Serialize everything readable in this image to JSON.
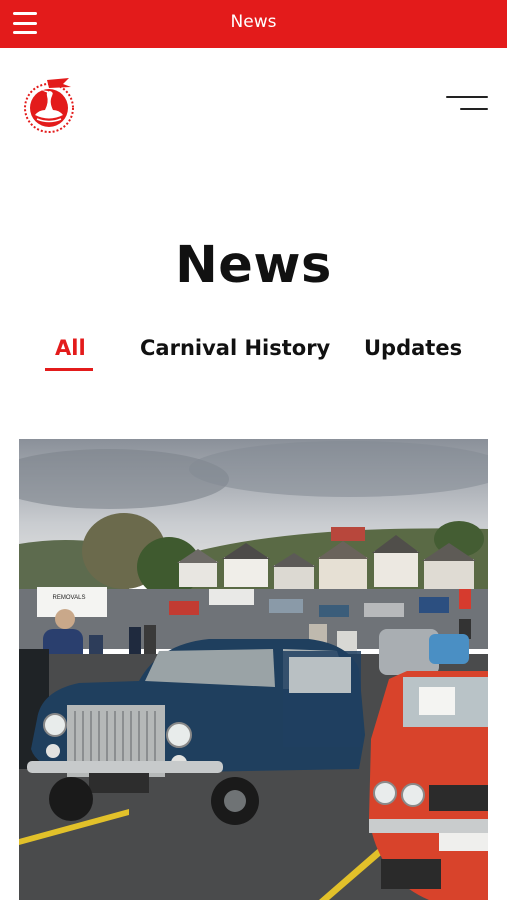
{
  "app_bar": {
    "title": "News",
    "menu_icon": "hamburger-menu-icon",
    "background_color": "#e31b1b"
  },
  "header": {
    "logo_icon": "swan-crest-logo",
    "menu_icon": "two-line-menu-icon"
  },
  "page": {
    "title": "News"
  },
  "tabs": [
    {
      "label": "All",
      "active": true
    },
    {
      "label": "Carnival History",
      "active": false
    },
    {
      "label": "Updates",
      "active": false
    }
  ],
  "featured_image": {
    "icon": "classic-car-show-photo",
    "van_text": "REMOVALS"
  },
  "colors": {
    "accent": "#e31b1b",
    "text": "#111111"
  }
}
